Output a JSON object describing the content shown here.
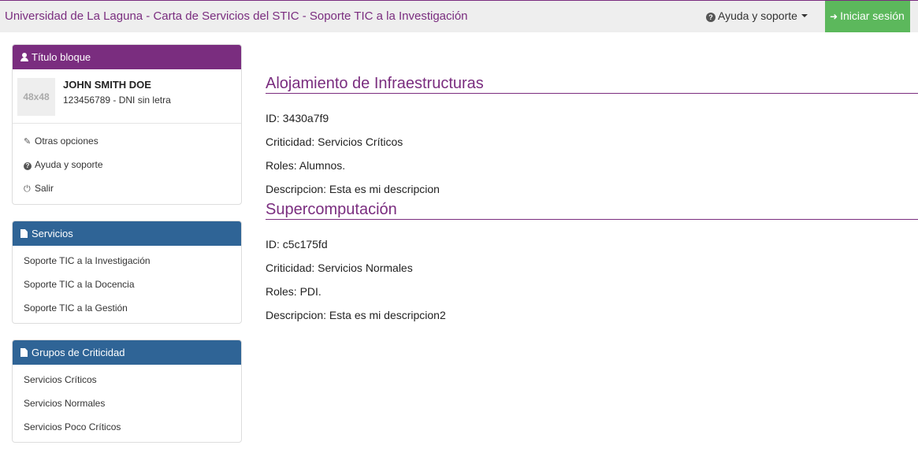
{
  "header": {
    "brand": "Universidad de La Laguna - Carta de Servicios del STIC - Soporte TIC a la Investigación",
    "help_label": "Ayuda y soporte",
    "login_label": "Iniciar sesión"
  },
  "user_panel": {
    "title": "Título bloque",
    "avatar_text": "48x48",
    "name": "JOHN SMITH DOE",
    "id_line": "123456789 - DNI sin letra",
    "options": [
      {
        "label": "Otras opciones",
        "icon": "pencil-icon"
      },
      {
        "label": "Ayuda y soporte",
        "icon": "question-circle-icon"
      },
      {
        "label": "Salir",
        "icon": "power-icon"
      }
    ]
  },
  "services_panel": {
    "title": "Servicios",
    "items": [
      "Soporte TIC a la Investigación",
      "Soporte TIC a la Docencia",
      "Soporte TIC a la Gestión"
    ]
  },
  "criticality_panel": {
    "title": "Grupos de Criticidad",
    "items": [
      "Servicios Críticos",
      "Servicios Normales",
      "Servicios Poco Críticos"
    ]
  },
  "services": [
    {
      "title": "Alojamiento de Infraestructuras",
      "id": "ID: 3430a7f9",
      "criticality": "Criticidad: Servicios Críticos",
      "roles": "Roles: Alumnos.",
      "description": "Descripcion: Esta es mi descripcion"
    },
    {
      "title": "Supercomputación",
      "id": "ID: c5c175fd",
      "criticality": "Criticidad: Servicios Normales",
      "roles": "Roles: PDI.",
      "description": "Descripcion: Esta es mi descripcion2"
    }
  ],
  "colors": {
    "brand_purple": "#7a2d7f",
    "panel_blue": "#2f6496",
    "login_green": "#5cb85c"
  }
}
